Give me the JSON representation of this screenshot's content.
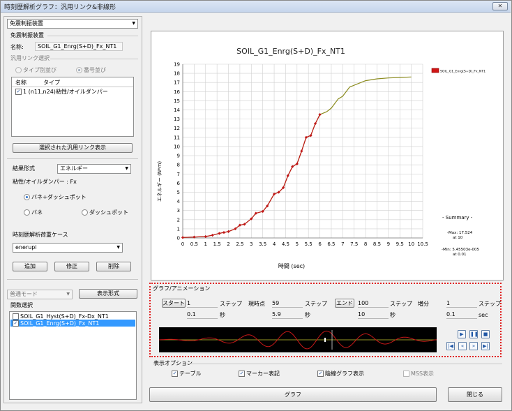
{
  "window": {
    "title": "時刻歴解析グラフ：汎用リンク&非線形",
    "close_label": "✕"
  },
  "left": {
    "top_combo": "免震制振装置",
    "group_title": "免震制振装置",
    "name_label": "名称:",
    "name_value": "SOIL_G1_Enrg(S+D)_Fx_NT1",
    "link_select_title": "汎用リンク選択",
    "radio_type": "タイプ別並び",
    "radio_number": "番号並び",
    "list_header_name": "名称",
    "list_header_type": "タイプ",
    "list_rows": [
      {
        "name": "1 (n11,n24)",
        "type": "粘性/オイルダンパー",
        "checked": true
      }
    ],
    "show_selected_button": "選択された汎用リンク表示",
    "result_format_label": "結果形式",
    "result_format_value": "エネルギー",
    "damper_label": "粘性/オイルダンパー : Fx",
    "radio_spring_dash": "バネ+ダッシュポット",
    "radio_spring": "バネ",
    "radio_dash": "ダッシュポット",
    "loadcase_label": "時刻歴解析荷重ケース",
    "loadcase_value": "enerupi",
    "add_button": "追加",
    "edit_button": "修正",
    "delete_button": "削除",
    "mode_combo": "普通モード",
    "display_format_button": "表示形式",
    "function_select_title": "関数選択",
    "functions": [
      {
        "label": "SOIL_G1_Hyst(S+D)_Fx-Dx_NT1",
        "checked": false,
        "selected": false
      },
      {
        "label": "SOIL_G1_Enrg(S+D)_Fx_NT1",
        "checked": true,
        "selected": true
      }
    ]
  },
  "chart_data": {
    "type": "line",
    "title": "SOIL_G1_Enrg(S+D)_Fx_NT1",
    "xlabel": "時間 (sec)",
    "ylabel": "エネルギー (N*m)",
    "xlim": [
      0,
      10.5
    ],
    "ylim": [
      0,
      19
    ],
    "x_ticks": [
      "0",
      "0.5",
      "1",
      "1.5",
      "2",
      "2.5",
      "3",
      "3.5",
      "4",
      "4.5",
      "5",
      "5.5",
      "6",
      "6.5",
      "7",
      "7.5",
      "8",
      "8.5",
      "9",
      "9.5",
      "10",
      "10.5"
    ],
    "y_ticks": [
      "0",
      "1",
      "2",
      "3",
      "4",
      "5",
      "6",
      "7",
      "8",
      "9",
      "10",
      "11",
      "12",
      "13",
      "14",
      "15",
      "16",
      "17",
      "18",
      "19"
    ],
    "grid": true,
    "legend": "top-right",
    "series": [
      {
        "name": "SOIL_G1_Enrg(S+D)_Fx_NT1",
        "x": [
          0,
          0.5,
          1.0,
          1.3,
          1.6,
          1.8,
          2.0,
          2.3,
          2.5,
          2.7,
          3.0,
          3.2,
          3.5,
          3.7,
          4.0,
          4.2,
          4.4,
          4.6,
          4.8,
          5.0,
          5.2,
          5.4,
          5.6,
          5.8,
          6.0,
          6.3,
          6.5,
          6.8,
          7.0,
          7.3,
          7.6,
          8.0,
          8.5,
          9.0,
          9.5,
          10.0
        ],
        "y": [
          0.05,
          0.1,
          0.15,
          0.3,
          0.5,
          0.6,
          0.7,
          1.0,
          1.4,
          1.5,
          2.1,
          2.7,
          2.9,
          3.5,
          4.8,
          5.0,
          5.5,
          6.8,
          7.8,
          8.1,
          9.5,
          11.0,
          11.2,
          12.5,
          13.5,
          13.8,
          14.2,
          15.2,
          15.5,
          16.5,
          16.8,
          17.2,
          17.4,
          17.5,
          17.55,
          17.6
        ]
      }
    ],
    "summary_title": "- Summary -",
    "summary_max": "-Max: 17.524\nat 10",
    "summary_min": "-Min: 5.45503e-005\nat 0.01"
  },
  "animation": {
    "group_title": "グラフ/アニメーション",
    "start_button": "スタート",
    "start_step": "1",
    "start_time": "0.1",
    "current_label": "現時点",
    "current_step": "59",
    "current_time": "5.9",
    "end_button": "エンド",
    "end_step": "100",
    "end_time": "10",
    "increment_label": "増分",
    "increment_step": "1",
    "increment_time": "0.1",
    "unit_step": "ステップ",
    "unit_sec": "秒",
    "unit_sec_en": "sec",
    "accent": "#1f57a6"
  },
  "display_options": {
    "title": "表示オプション",
    "table": "テーブル",
    "marker": "マーカー表記",
    "hidden_line": "陰線グラフ表示",
    "mss": "MSS表示"
  },
  "bottom": {
    "graph_button": "グラフ",
    "close_button": "閉じる"
  }
}
